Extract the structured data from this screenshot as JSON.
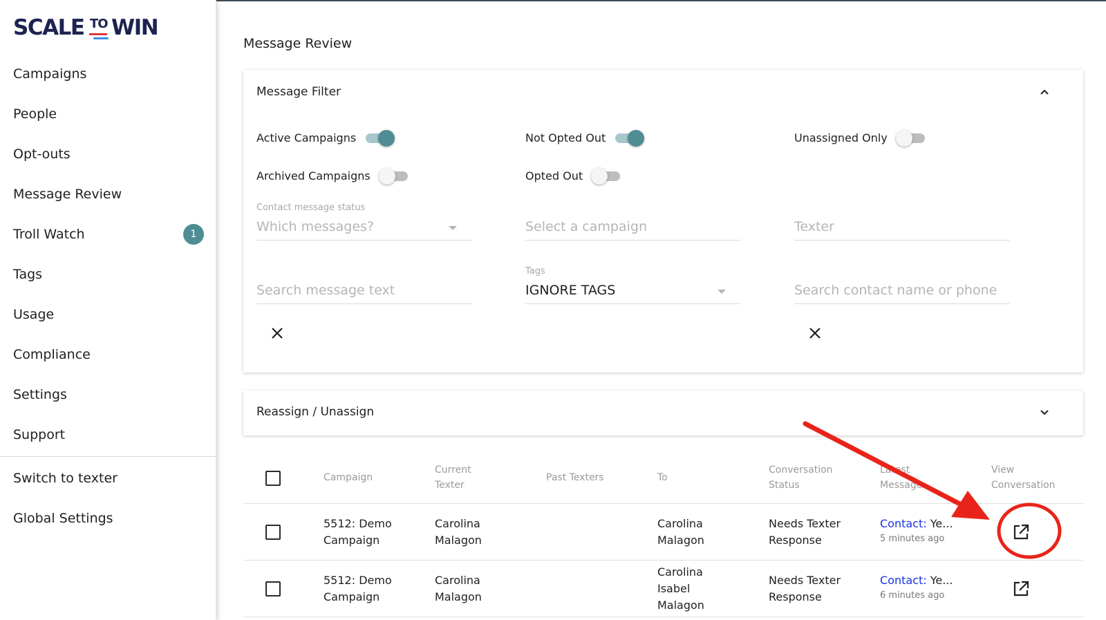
{
  "logo": {
    "part1": "SCALE",
    "part2": "TO",
    "part3": "WIN"
  },
  "sidebar": {
    "items": [
      {
        "label": "Campaigns"
      },
      {
        "label": "People"
      },
      {
        "label": "Opt-outs"
      },
      {
        "label": "Message Review"
      },
      {
        "label": "Troll Watch",
        "badge": "1"
      },
      {
        "label": "Tags"
      },
      {
        "label": "Usage"
      },
      {
        "label": "Compliance"
      },
      {
        "label": "Settings"
      },
      {
        "label": "Support"
      }
    ],
    "bottom_items": [
      {
        "label": "Switch to texter"
      },
      {
        "label": "Global Settings"
      }
    ]
  },
  "page": {
    "title": "Message Review"
  },
  "filter": {
    "header": "Message Filter",
    "toggles": {
      "active_campaigns": {
        "label": "Active Campaigns",
        "state": "on"
      },
      "not_opted_out": {
        "label": "Not Opted Out",
        "state": "on"
      },
      "unassigned_only": {
        "label": "Unassigned Only",
        "state": "off"
      },
      "archived_campaigns": {
        "label": "Archived Campaigns",
        "state": "off"
      },
      "opted_out": {
        "label": "Opted Out",
        "state": "off"
      }
    },
    "contact_status": {
      "label": "Contact message status",
      "placeholder": "Which messages?"
    },
    "campaign": {
      "placeholder": "Select a campaign"
    },
    "texter": {
      "placeholder": "Texter"
    },
    "search_text": {
      "placeholder": "Search message text"
    },
    "tags": {
      "label": "Tags",
      "value": "IGNORE TAGS"
    },
    "search_contact": {
      "placeholder": "Search contact name or phone"
    }
  },
  "reassign": {
    "header": "Reassign / Unassign"
  },
  "table": {
    "headers": {
      "campaign": "Campaign",
      "current_texter_1": "Current",
      "current_texter_2": "Texter",
      "past_texters": "Past Texters",
      "to": "To",
      "conversation_status_1": "Conversation",
      "conversation_status_2": "Status",
      "latest_message_1": "Latest",
      "latest_message_2": "Message",
      "view_conversation_1": "View",
      "view_conversation_2": "Conversation"
    },
    "rows": [
      {
        "campaign_1": "5512: Demo",
        "campaign_2": "Campaign",
        "texter_1": "Carolina",
        "texter_2": "Malagon",
        "to_1": "Carolina",
        "to_2": "Malagon",
        "to_3": "",
        "status_1": "Needs Texter",
        "status_2": "Response",
        "msg_label": "Contact:",
        "msg_text": " Ye...",
        "msg_time": "5 minutes ago"
      },
      {
        "campaign_1": "5512: Demo",
        "campaign_2": "Campaign",
        "texter_1": "Carolina",
        "texter_2": "Malagon",
        "to_1": "Carolina",
        "to_2": "Isabel",
        "to_3": "Malagon",
        "status_1": "Needs Texter",
        "status_2": "Response",
        "msg_label": "Contact:",
        "msg_text": " Ye...",
        "msg_time": "6 minutes ago"
      }
    ]
  },
  "colors": {
    "accent": "#4f8d95",
    "brand": "#1d2350",
    "link": "#1a35e0",
    "annotation": "#e8241a"
  }
}
